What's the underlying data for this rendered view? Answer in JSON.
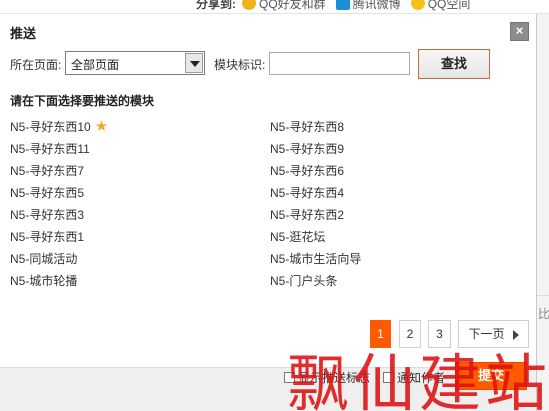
{
  "background": {
    "share_label": "分享到:",
    "share_items": [
      "QQ好友和群",
      "腾讯微博",
      "QQ空间"
    ],
    "right_edge_text": "比"
  },
  "dialog": {
    "title": "推送",
    "close_label": "×",
    "filter": {
      "page_label": "所在页面:",
      "page_select_value": "全部页面",
      "module_id_label": "模块标识:",
      "module_id_value": "",
      "search_button": "查找"
    },
    "section_hint": "请在下面选择要推送的模块",
    "modules_left": [
      "N5-寻好东西10",
      "N5-寻好东西11",
      "N5-寻好东西7",
      "N5-寻好东西5",
      "N5-寻好东西3",
      "N5-寻好东西1",
      "N5-同城活动",
      "N5-城市轮播"
    ],
    "modules_right": [
      "N5-寻好东西8",
      "N5-寻好东西9",
      "N5-寻好东西6",
      "N5-寻好东西4",
      "N5-寻好东西2",
      "N5-逛花坛",
      "N5-城市生活向导",
      "N5-门户头条"
    ],
    "starred_module": "N5-寻好东西10",
    "star_icon": "star-icon",
    "pagination": {
      "pages": [
        "1",
        "2",
        "3"
      ],
      "current": "1",
      "next_label": "下一页"
    },
    "footer": {
      "checkbox1_label": "显示推送标志",
      "checkbox2_label": "通知作者",
      "submit_button": "提交"
    }
  },
  "watermark": "飘仙建站",
  "colors": {
    "accent": "#ff5a00",
    "search_border": "#c86a3c",
    "star": "#f0a830",
    "watermark": "#dd1111",
    "close_bg": "#8c8c8c"
  }
}
